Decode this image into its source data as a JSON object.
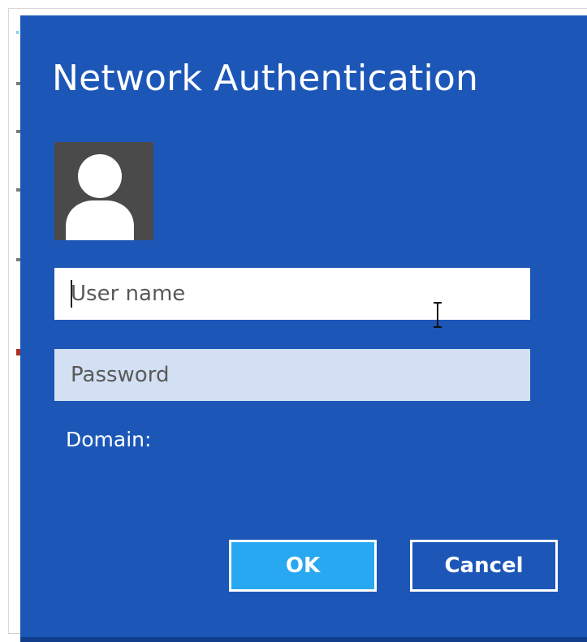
{
  "dialog": {
    "title": "Network Authentication",
    "username": {
      "value": "",
      "placeholder": "User name"
    },
    "password": {
      "value": "",
      "placeholder": "Password"
    },
    "domain_label": "Domain:",
    "ok_label": "OK",
    "cancel_label": "Cancel"
  },
  "icons": {
    "avatar": "user-silhouette-icon",
    "cursor": "text-cursor-icon"
  },
  "colors": {
    "dialog_background": "#1c57b8",
    "ok_button": "#28a8f0",
    "password_field": "#d3e0f3",
    "avatar_background": "#4a4a4a"
  }
}
